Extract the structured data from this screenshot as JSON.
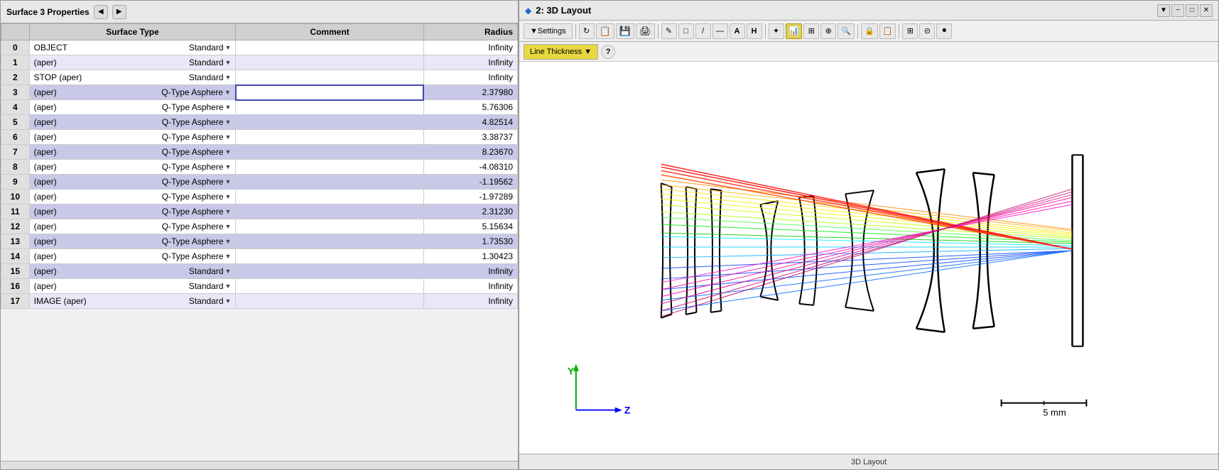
{
  "leftPanel": {
    "title": "Surface  3 Properties",
    "columns": [
      "Surface Type",
      "Comment",
      "Radius"
    ],
    "rows": [
      {
        "num": "0",
        "name": "OBJECT",
        "type": "Standard",
        "comment": "",
        "radius": "Infinity",
        "highlighted": false,
        "editing": false
      },
      {
        "num": "1",
        "name": "(aper)",
        "type": "Standard",
        "comment": "",
        "radius": "Infinity",
        "highlighted": false,
        "editing": false
      },
      {
        "num": "2",
        "name": "STOP (aper)",
        "type": "Standard",
        "comment": "",
        "radius": "Infinity",
        "highlighted": false,
        "editing": false
      },
      {
        "num": "3",
        "name": "(aper)",
        "type": "Q-Type Asphere",
        "comment": "",
        "radius": "2.37980",
        "highlighted": true,
        "editing": true
      },
      {
        "num": "4",
        "name": "(aper)",
        "type": "Q-Type Asphere",
        "comment": "",
        "radius": "5.76306",
        "highlighted": false,
        "editing": false
      },
      {
        "num": "5",
        "name": "(aper)",
        "type": "Q-Type Asphere",
        "comment": "",
        "radius": "4.82514",
        "highlighted": true,
        "editing": false
      },
      {
        "num": "6",
        "name": "(aper)",
        "type": "Q-Type Asphere",
        "comment": "",
        "radius": "3.38737",
        "highlighted": false,
        "editing": false
      },
      {
        "num": "7",
        "name": "(aper)",
        "type": "Q-Type Asphere",
        "comment": "",
        "radius": "8.23670",
        "highlighted": true,
        "editing": false
      },
      {
        "num": "8",
        "name": "(aper)",
        "type": "Q-Type Asphere",
        "comment": "",
        "radius": "-4.08310",
        "highlighted": false,
        "editing": false
      },
      {
        "num": "9",
        "name": "(aper)",
        "type": "Q-Type Asphere",
        "comment": "",
        "radius": "-1.19562",
        "highlighted": true,
        "editing": false
      },
      {
        "num": "10",
        "name": "(aper)",
        "type": "Q-Type Asphere",
        "comment": "",
        "radius": "-1.97289",
        "highlighted": false,
        "editing": false
      },
      {
        "num": "11",
        "name": "(aper)",
        "type": "Q-Type Asphere",
        "comment": "",
        "radius": "2.31230",
        "highlighted": true,
        "editing": false
      },
      {
        "num": "12",
        "name": "(aper)",
        "type": "Q-Type Asphere",
        "comment": "",
        "radius": "5.15634",
        "highlighted": false,
        "editing": false
      },
      {
        "num": "13",
        "name": "(aper)",
        "type": "Q-Type Asphere",
        "comment": "",
        "radius": "1.73530",
        "highlighted": true,
        "editing": false
      },
      {
        "num": "14",
        "name": "(aper)",
        "type": "Q-Type Asphere",
        "comment": "",
        "radius": "1.30423",
        "highlighted": false,
        "editing": false
      },
      {
        "num": "15",
        "name": "(aper)",
        "type": "Standard",
        "comment": "",
        "radius": "Infinity",
        "highlighted": true,
        "editing": false
      },
      {
        "num": "16",
        "name": "(aper)",
        "type": "Standard",
        "comment": "",
        "radius": "Infinity",
        "highlighted": false,
        "editing": false
      },
      {
        "num": "17",
        "name": "IMAGE (aper)",
        "type": "Standard",
        "comment": "",
        "radius": "Infinity",
        "highlighted": false,
        "editing": false
      }
    ]
  },
  "rightPanel": {
    "title": "2: 3D Layout",
    "toolbar": {
      "settings_label": "Settings",
      "line_thickness_label": "Line Thickness",
      "help_symbol": "?",
      "icons": [
        "↻",
        "📋",
        "💾",
        "🖨",
        "✏",
        "□",
        "/",
        "—",
        "A",
        "H",
        "✦",
        "📊",
        "🔲",
        "⊕",
        "🔍",
        "🔒",
        "📋",
        "⊞",
        "⊟",
        "⏺"
      ]
    },
    "statusBar": "3D Layout",
    "scaleBar": "5 mm",
    "axes": {
      "y_label": "Y",
      "z_label": "Z"
    }
  }
}
